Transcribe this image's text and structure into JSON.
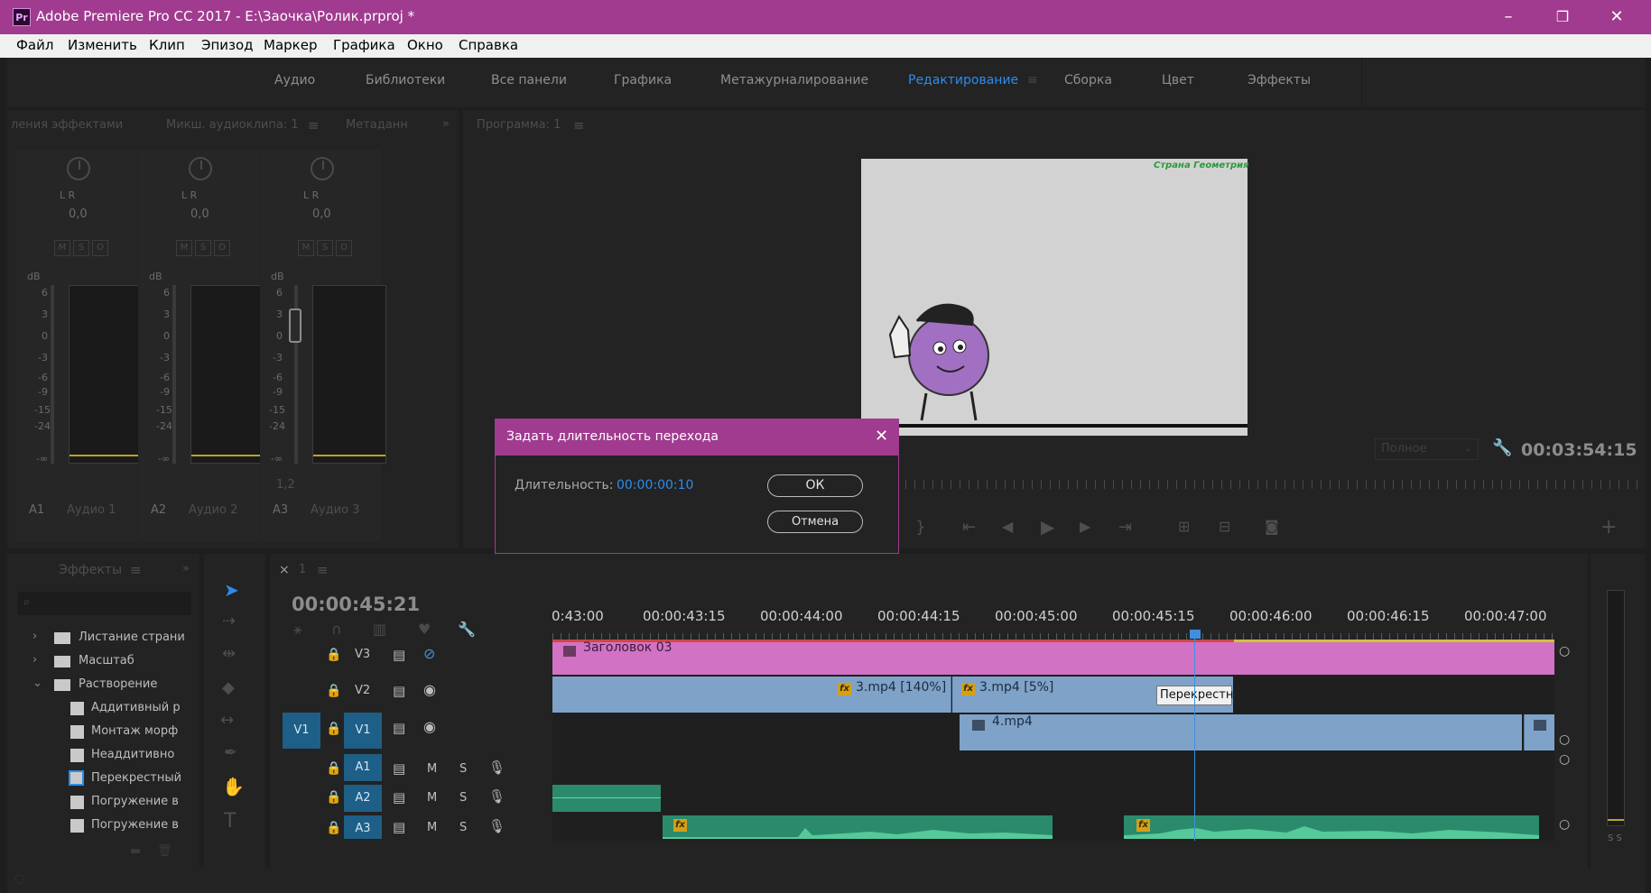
{
  "window": {
    "app_badge": "Pr",
    "title": "Adobe Premiere Pro CC 2017 - E:\\Заочка\\Ролик.prproj *",
    "minimize": "–",
    "restore": "❐",
    "close": "✕"
  },
  "menu": [
    "Файл",
    "Изменить",
    "Клип",
    "Эпизод",
    "Маркер",
    "Графика",
    "Окно",
    "Справка"
  ],
  "workspaces": [
    "Аудио",
    "Библиотеки",
    "Все панели",
    "Графика",
    "Метажурналирование",
    "Редактирование",
    "Сборка",
    "Цвет",
    "Эффекты"
  ],
  "active_workspace": "Редактирование",
  "left_panel": {
    "tabs": [
      "ления эффектами",
      "Микш. аудиоклипа: 1",
      "Метаданн"
    ],
    "menu_icon": "≡",
    "more_icon": "»",
    "channels": [
      {
        "lr": "L  R",
        "value": "0,0",
        "track": "A1",
        "name": "Аудио 1"
      },
      {
        "lr": "L  R",
        "value": "0,0",
        "track": "A2",
        "name": "Аудио 2"
      },
      {
        "lr": "L  R",
        "value": "0,0",
        "track": "A3",
        "name": "Аудио 3"
      }
    ],
    "msr": [
      "M",
      "S",
      "O"
    ],
    "db_label": "dB",
    "scale": [
      "6",
      "3",
      "0",
      "-3",
      "-6",
      "-9",
      "-15",
      "-24",
      "-∞"
    ],
    "fader_value_3": "1,2"
  },
  "program_monitor": {
    "tab": "Программа: 1",
    "menu_icon": "≡",
    "video_caption": "Страна Геометрия",
    "quality": "Полное",
    "timecode": "00:03:54:15",
    "add_button": "+"
  },
  "dialog": {
    "title": "Задать длительность перехода",
    "label": "Длительность:",
    "value": "00:00:00:10",
    "ok": "ОК",
    "cancel": "Отмена",
    "close": "✕"
  },
  "effects_panel": {
    "tab": "Эффекты",
    "menu_icon": "≡",
    "more_icon": "»",
    "search_placeholder": "",
    "items": [
      {
        "label": "Листание страни",
        "type": "folder",
        "expanded": false
      },
      {
        "label": "Масштаб",
        "type": "folder",
        "expanded": false
      },
      {
        "label": "Растворение",
        "type": "folder",
        "expanded": true
      },
      {
        "label": "Аддитивный р",
        "type": "effect"
      },
      {
        "label": "Монтаж морф",
        "type": "effect"
      },
      {
        "label": "Неаддитивно",
        "type": "effect"
      },
      {
        "label": "Перекрестный",
        "type": "effect",
        "selected": true
      },
      {
        "label": "Погружение в",
        "type": "effect"
      },
      {
        "label": "Погружение в",
        "type": "effect"
      }
    ]
  },
  "timeline": {
    "tab_close": "×",
    "tab": "1",
    "menu_icon": "≡",
    "timecode": "00:00:45:21",
    "ruler": [
      "0:43:00",
      "00:00:43:15",
      "00:00:44:00",
      "00:00:44:15",
      "00:00:45:00",
      "00:00:45:15",
      "00:00:46:00",
      "00:00:46:15",
      "00:00:47:00"
    ],
    "tracks": [
      {
        "id": "V3",
        "kind": "video"
      },
      {
        "id": "V2",
        "kind": "video"
      },
      {
        "id": "V1",
        "kind": "video",
        "source": "V1"
      },
      {
        "id": "A1",
        "kind": "audio"
      },
      {
        "id": "A2",
        "kind": "audio"
      },
      {
        "id": "A3",
        "kind": "audio"
      }
    ],
    "audio_buttons": [
      "M",
      "S"
    ],
    "clips": {
      "v3_title": "Заголовок 03",
      "v2_a": "3.mp4 [140%]",
      "v2_b": "3.mp4 [5%]",
      "v2_transition": "Перекрестн",
      "v1": "4.mp4"
    },
    "fx_label": "fx",
    "meter_label": "S S"
  },
  "colors": {
    "accent": "#a03b8f",
    "blue": "#2d8ceb",
    "clip_pink": "#d172c5",
    "clip_blue": "#7fa2c8",
    "clip_green": "#2a8a6b"
  }
}
